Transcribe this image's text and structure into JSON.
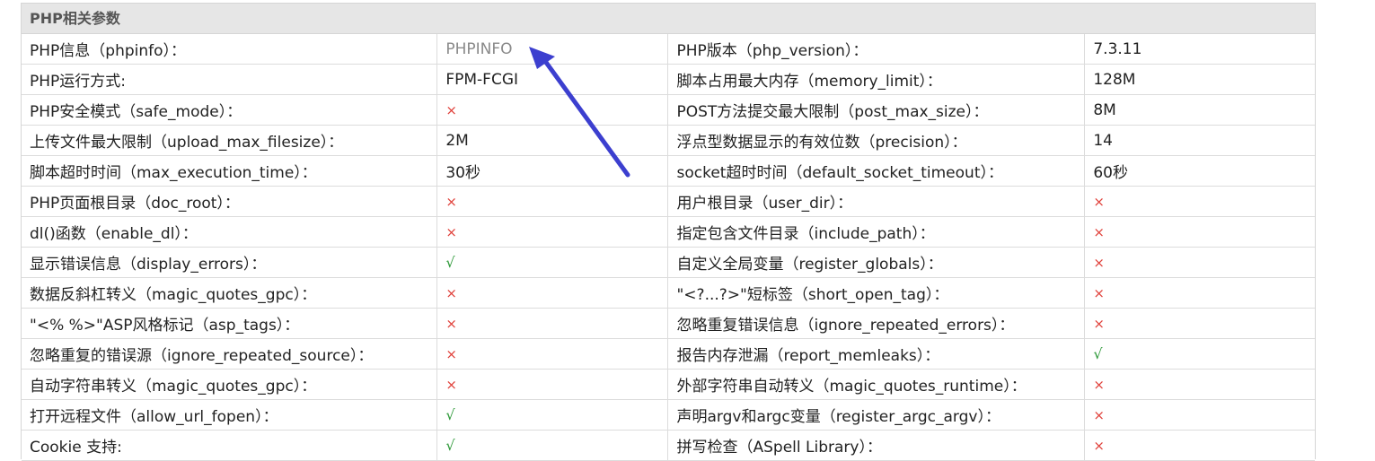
{
  "header": {
    "title": "PHP相关参数"
  },
  "rows": [
    [
      {
        "t": "PHP信息（phpinfo）："
      },
      {
        "t": "PHPINFO",
        "k": "link"
      },
      {
        "t": "PHP版本（php_version）："
      },
      {
        "t": "7.3.11"
      }
    ],
    [
      {
        "t": "PHP运行方式:"
      },
      {
        "t": "FPM-FCGI"
      },
      {
        "t": "脚本占用最大内存（memory_limit）："
      },
      {
        "t": "128M"
      }
    ],
    [
      {
        "t": "PHP安全模式（safe_mode）："
      },
      {
        "t": "×",
        "k": "cross"
      },
      {
        "t": "POST方法提交最大限制（post_max_size）："
      },
      {
        "t": "8M"
      }
    ],
    [
      {
        "t": "上传文件最大限制（upload_max_filesize）："
      },
      {
        "t": "2M"
      },
      {
        "t": "浮点型数据显示的有效位数（precision）："
      },
      {
        "t": "14"
      }
    ],
    [
      {
        "t": "脚本超时时间（max_execution_time）："
      },
      {
        "t": "30秒"
      },
      {
        "t": "socket超时时间（default_socket_timeout）："
      },
      {
        "t": "60秒"
      }
    ],
    [
      {
        "t": "PHP页面根目录（doc_root）："
      },
      {
        "t": "×",
        "k": "cross"
      },
      {
        "t": "用户根目录（user_dir）："
      },
      {
        "t": "×",
        "k": "cross"
      }
    ],
    [
      {
        "t": "dl()函数（enable_dl）："
      },
      {
        "t": "×",
        "k": "cross"
      },
      {
        "t": "指定包含文件目录（include_path）："
      },
      {
        "t": "×",
        "k": "cross"
      }
    ],
    [
      {
        "t": "显示错误信息（display_errors）："
      },
      {
        "t": "√",
        "k": "check"
      },
      {
        "t": "自定义全局变量（register_globals）："
      },
      {
        "t": "×",
        "k": "cross"
      }
    ],
    [
      {
        "t": "数据反斜杠转义（magic_quotes_gpc）："
      },
      {
        "t": "×",
        "k": "cross"
      },
      {
        "t": "\"<?...?>\"短标签（short_open_tag）："
      },
      {
        "t": "×",
        "k": "cross"
      }
    ],
    [
      {
        "t": "\"<% %>\"ASP风格标记（asp_tags）："
      },
      {
        "t": "×",
        "k": "cross"
      },
      {
        "t": "忽略重复错误信息（ignore_repeated_errors）："
      },
      {
        "t": "×",
        "k": "cross"
      }
    ],
    [
      {
        "t": "忽略重复的错误源（ignore_repeated_source）："
      },
      {
        "t": "×",
        "k": "cross"
      },
      {
        "t": "报告内存泄漏（report_memleaks）："
      },
      {
        "t": "√",
        "k": "check"
      }
    ],
    [
      {
        "t": "自动字符串转义（magic_quotes_gpc）："
      },
      {
        "t": "×",
        "k": "cross"
      },
      {
        "t": "外部字符串自动转义（magic_quotes_runtime）："
      },
      {
        "t": "×",
        "k": "cross"
      }
    ],
    [
      {
        "t": "打开远程文件（allow_url_fopen）："
      },
      {
        "t": "√",
        "k": "check"
      },
      {
        "t": "声明argv和argc变量（register_argc_argv）："
      },
      {
        "t": "×",
        "k": "cross"
      }
    ],
    [
      {
        "t": "Cookie 支持:"
      },
      {
        "t": "√",
        "k": "check"
      },
      {
        "t": "拼写检查（ASpell Library）："
      },
      {
        "t": "×",
        "k": "cross"
      }
    ]
  ],
  "colors": {
    "cross": "#e0403a",
    "check": "#2f9a3a",
    "arrow": "#3c3fcf"
  }
}
